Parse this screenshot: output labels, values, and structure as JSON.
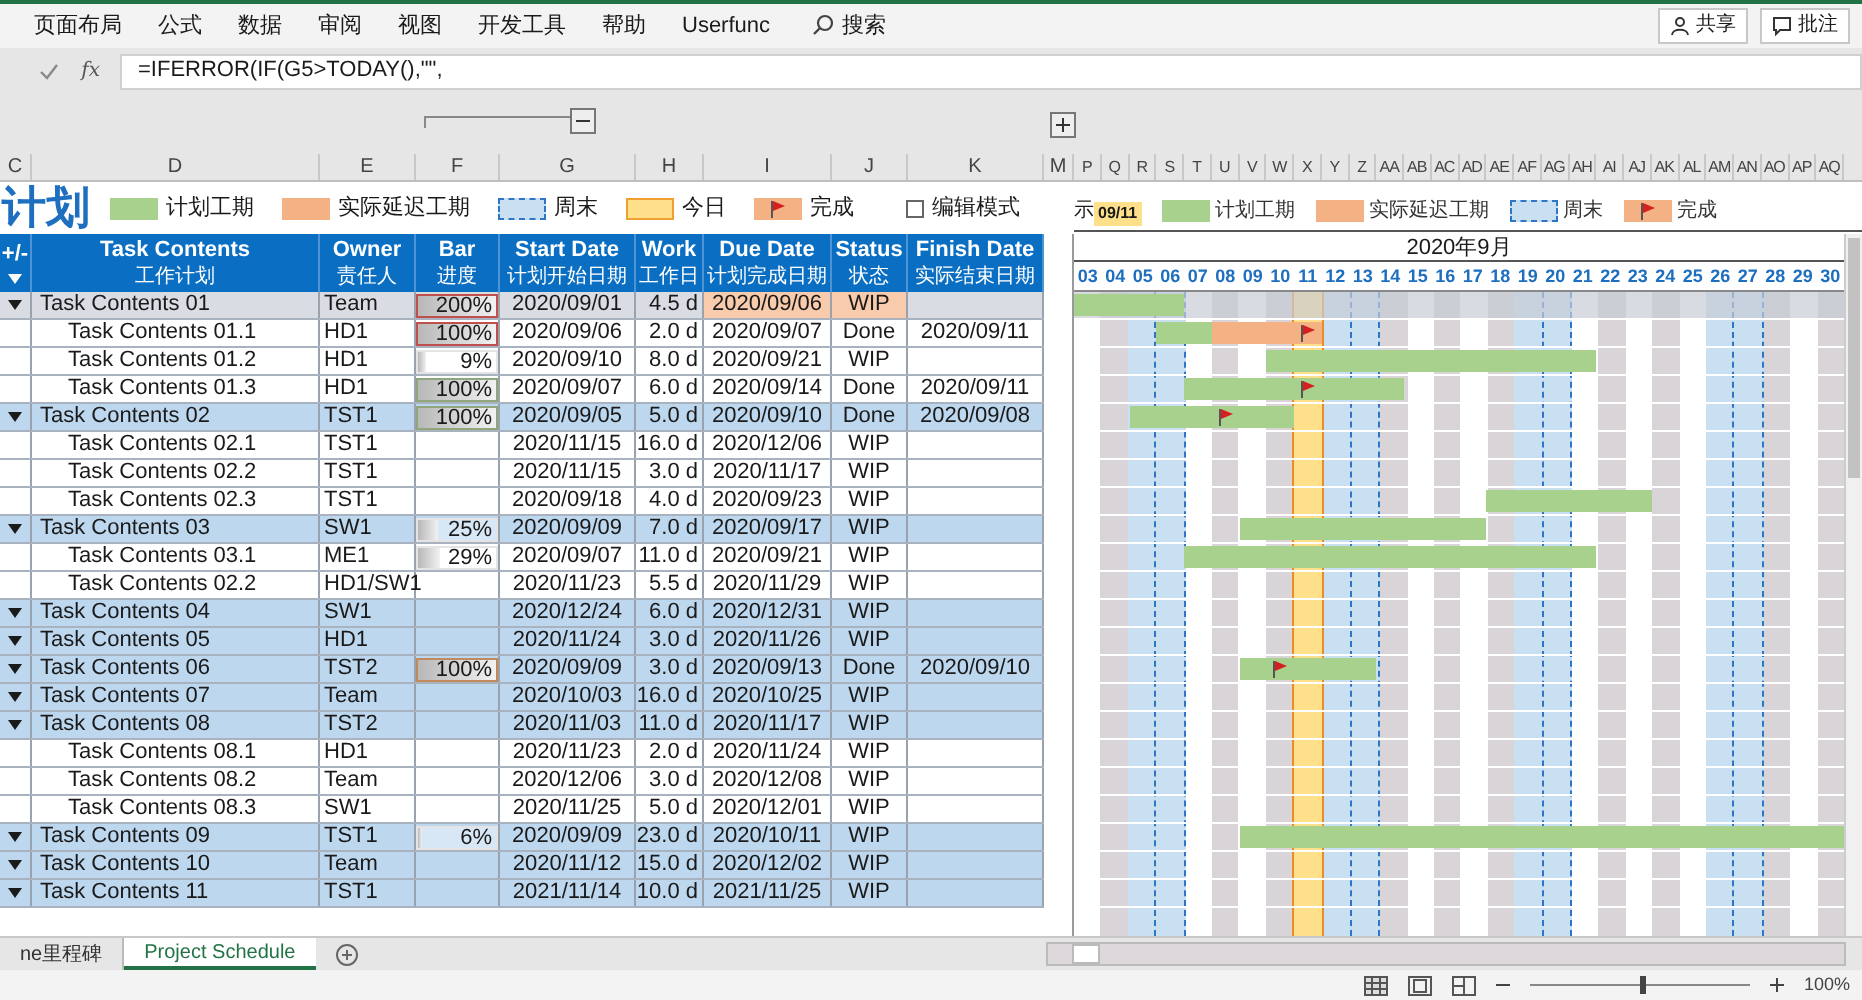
{
  "ribbon": {
    "tabs": [
      "页面布局",
      "公式",
      "数据",
      "审阅",
      "视图",
      "开发工具",
      "帮助",
      "Userfunc"
    ],
    "search": "搜索",
    "buttons": [
      "共享",
      "批注"
    ]
  },
  "formula_bar": {
    "fx": "fx",
    "formula": "=IFERROR(IF(G5>TODAY(),\"\","
  },
  "column_letters": {
    "left": [
      "C",
      "D",
      "E",
      "F",
      "G",
      "H",
      "I",
      "J",
      "K"
    ],
    "gap": "M",
    "right": [
      "P",
      "Q",
      "R",
      "S",
      "T",
      "U",
      "V",
      "W",
      "X",
      "Y",
      "Z",
      "AA",
      "AB",
      "AC",
      "AD",
      "AE",
      "AF",
      "AG",
      "AH",
      "AI",
      "AJ",
      "AK",
      "AL",
      "AM",
      "AN",
      "AO",
      "AP",
      "AQ"
    ]
  },
  "title": "计划",
  "legend": [
    {
      "kind": "plan",
      "label": "计划工期"
    },
    {
      "kind": "delay",
      "label": "实际延迟工期"
    },
    {
      "kind": "weekend",
      "label": "周末"
    },
    {
      "kind": "today",
      "label": "今日"
    },
    {
      "kind": "done",
      "label": "完成"
    }
  ],
  "edit_mode": {
    "label": "编辑模式",
    "checked": false
  },
  "gantt_legend": {
    "prefix": "示",
    "today": "09/11",
    "items": [
      {
        "kind": "plan",
        "label": "计划工期"
      },
      {
        "kind": "delay",
        "label": "实际延迟工期"
      },
      {
        "kind": "weekend",
        "label": "周末"
      },
      {
        "kind": "done",
        "label": "完成"
      }
    ]
  },
  "table": {
    "columns": [
      {
        "line1": "+/-",
        "kind": "outline"
      },
      {
        "line1": "Task Contents",
        "line2": "工作计划"
      },
      {
        "line1": "Owner",
        "line2": "责任人"
      },
      {
        "line1": "Bar",
        "line2": "进度"
      },
      {
        "line1": "Start Date",
        "line2": "计划开始日期"
      },
      {
        "line1": "Work",
        "line2": "工作日"
      },
      {
        "line1": "Due Date",
        "line2": "计划完成日期"
      },
      {
        "line1": "Status",
        "line2": "状态"
      },
      {
        "line1": "Finish Date",
        "line2": "实际结束日期"
      }
    ],
    "rows": [
      {
        "kind": "group",
        "selected": true,
        "overdue": true,
        "name": "Task Contents 01",
        "owner": "Team",
        "progress": {
          "text": "200%",
          "level": 1,
          "color": "#c0504d"
        },
        "start": "2020/09/01",
        "work": "4.5 d",
        "due": "2020/09/06",
        "status": "WIP"
      },
      {
        "kind": "task",
        "selected": false,
        "overdue": false,
        "name": "Task Contents 01.1",
        "owner": "HD1",
        "progress": {
          "text": "100%",
          "level": 1,
          "color": "#c0504d"
        },
        "start": "2020/09/06",
        "work": "2.0 d",
        "due": "2020/09/07",
        "status": "Done",
        "finish": "2020/09/11"
      },
      {
        "kind": "task",
        "selected": false,
        "overdue": false,
        "name": "Task Contents 01.2",
        "owner": "HD1",
        "progress": {
          "text": "9%",
          "level": 0.09
        },
        "start": "2020/09/10",
        "work": "8.0 d",
        "due": "2020/09/21",
        "status": "WIP"
      },
      {
        "kind": "task",
        "selected": false,
        "overdue": false,
        "name": "Task Contents 01.3",
        "owner": "HD1",
        "progress": {
          "text": "100%",
          "level": 1,
          "color": "#8fa67c"
        },
        "start": "2020/09/07",
        "work": "6.0 d",
        "due": "2020/09/14",
        "status": "Done",
        "finish": "2020/09/11"
      },
      {
        "kind": "group",
        "selected": false,
        "overdue": false,
        "name": "Task Contents 02",
        "owner": "TST1",
        "progress": {
          "text": "100%",
          "level": 1,
          "color": "#8fa67c"
        },
        "start": "2020/09/05",
        "work": "5.0 d",
        "due": "2020/09/10",
        "status": "Done",
        "finish": "2020/09/08"
      },
      {
        "kind": "task",
        "selected": false,
        "overdue": false,
        "name": "Task Contents 02.1",
        "owner": "TST1",
        "start": "2020/11/15",
        "work": "16.0 d",
        "due": "2020/12/06",
        "status": "WIP"
      },
      {
        "kind": "task",
        "selected": false,
        "overdue": false,
        "name": "Task Contents 02.2",
        "owner": "TST1",
        "start": "2020/11/15",
        "work": "3.0 d",
        "due": "2020/11/17",
        "status": "WIP"
      },
      {
        "kind": "task",
        "selected": false,
        "overdue": false,
        "name": "Task Contents 02.3",
        "owner": "TST1",
        "start": "2020/09/18",
        "work": "4.0 d",
        "due": "2020/09/23",
        "status": "WIP"
      },
      {
        "kind": "group",
        "selected": false,
        "overdue": false,
        "name": "Task Contents 03",
        "owner": "SW1",
        "progress": {
          "text": "25%",
          "level": 0.25
        },
        "start": "2020/09/09",
        "work": "7.0 d",
        "due": "2020/09/17",
        "status": "WIP"
      },
      {
        "kind": "task",
        "selected": false,
        "overdue": false,
        "name": "Task Contents 03.1",
        "owner": "ME1",
        "progress": {
          "text": "29%",
          "level": 0.29
        },
        "start": "2020/09/07",
        "work": "11.0 d",
        "due": "2020/09/21",
        "status": "WIP"
      },
      {
        "kind": "task",
        "selected": false,
        "overdue": false,
        "name": "Task Contents 02.2",
        "owner": "HD1/SW1",
        "start": "2020/11/23",
        "work": "5.5 d",
        "due": "2020/11/29",
        "status": "WIP"
      },
      {
        "kind": "group",
        "selected": false,
        "overdue": false,
        "name": "Task Contents 04",
        "owner": "SW1",
        "start": "2020/12/24",
        "work": "6.0 d",
        "due": "2020/12/31",
        "status": "WIP"
      },
      {
        "kind": "group",
        "selected": false,
        "overdue": false,
        "name": "Task Contents 05",
        "owner": "HD1",
        "start": "2020/11/24",
        "work": "3.0 d",
        "due": "2020/11/26",
        "status": "WIP"
      },
      {
        "kind": "group",
        "selected": false,
        "overdue": false,
        "name": "Task Contents 06",
        "owner": "TST2",
        "progress": {
          "text": "100%",
          "level": 1,
          "color": "#c08a5a"
        },
        "start": "2020/09/09",
        "work": "3.0 d",
        "due": "2020/09/13",
        "status": "Done",
        "finish": "2020/09/10"
      },
      {
        "kind": "group",
        "selected": false,
        "overdue": false,
        "name": "Task Contents 07",
        "owner": "Team",
        "start": "2020/10/03",
        "work": "16.0 d",
        "due": "2020/10/25",
        "status": "WIP"
      },
      {
        "kind": "group",
        "selected": false,
        "overdue": false,
        "name": "Task Contents 08",
        "owner": "TST2",
        "start": "2020/11/03",
        "work": "11.0 d",
        "due": "2020/11/17",
        "status": "WIP"
      },
      {
        "kind": "task",
        "selected": false,
        "overdue": false,
        "name": "Task Contents 08.1",
        "owner": "HD1",
        "start": "2020/11/23",
        "work": "2.0 d",
        "due": "2020/11/24",
        "status": "WIP"
      },
      {
        "kind": "task",
        "selected": false,
        "overdue": false,
        "name": "Task Contents 08.2",
        "owner": "Team",
        "start": "2020/12/06",
        "work": "3.0 d",
        "due": "2020/12/08",
        "status": "WIP"
      },
      {
        "kind": "task",
        "selected": false,
        "overdue": false,
        "name": "Task Contents 08.3",
        "owner": "SW1",
        "start": "2020/11/25",
        "work": "5.0 d",
        "due": "2020/12/01",
        "status": "WIP"
      },
      {
        "kind": "group",
        "selected": false,
        "overdue": false,
        "name": "Task Contents 09",
        "owner": "TST1",
        "progress": {
          "text": "6%",
          "level": 0.06
        },
        "start": "2020/09/09",
        "work": "23.0 d",
        "due": "2020/10/11",
        "status": "WIP"
      },
      {
        "kind": "group",
        "selected": false,
        "overdue": false,
        "name": "Task Contents 10",
        "owner": "Team",
        "start": "2020/11/12",
        "work": "15.0 d",
        "due": "2020/12/02",
        "status": "WIP"
      },
      {
        "kind": "group",
        "selected": false,
        "overdue": false,
        "name": "Task Contents 11",
        "owner": "TST1",
        "start": "2021/11/14",
        "work": "10.0 d",
        "due": "2021/11/25",
        "status": "WIP"
      }
    ]
  },
  "gantt": {
    "month": "2020年9月",
    "days": [
      {
        "label": "03",
        "kind": "day"
      },
      {
        "label": "04",
        "kind": "day"
      },
      {
        "label": "05",
        "kind": "weekend"
      },
      {
        "label": "06",
        "kind": "weekend"
      },
      {
        "label": "07",
        "kind": "day"
      },
      {
        "label": "08",
        "kind": "day"
      },
      {
        "label": "09",
        "kind": "day"
      },
      {
        "label": "10",
        "kind": "day"
      },
      {
        "label": "11",
        "kind": "today"
      },
      {
        "label": "12",
        "kind": "weekend"
      },
      {
        "label": "13",
        "kind": "weekend"
      },
      {
        "label": "14",
        "kind": "day"
      },
      {
        "label": "15",
        "kind": "day"
      },
      {
        "label": "16",
        "kind": "day"
      },
      {
        "label": "17",
        "kind": "day"
      },
      {
        "label": "18",
        "kind": "day"
      },
      {
        "label": "19",
        "kind": "weekend"
      },
      {
        "label": "20",
        "kind": "weekend"
      },
      {
        "label": "21",
        "kind": "day"
      },
      {
        "label": "22",
        "kind": "day"
      },
      {
        "label": "23",
        "kind": "day"
      },
      {
        "label": "24",
        "kind": "day"
      },
      {
        "label": "25",
        "kind": "day"
      },
      {
        "label": "26",
        "kind": "weekend"
      },
      {
        "label": "27",
        "kind": "weekend"
      },
      {
        "label": "28",
        "kind": "day"
      },
      {
        "label": "29",
        "kind": "day"
      },
      {
        "label": "30",
        "kind": "day"
      }
    ]
  },
  "sheet_tabs": [
    {
      "label": "ne里程碑",
      "selected": false
    },
    {
      "label": "Project Schedule",
      "selected": true
    }
  ],
  "status_bar": {
    "zoom": "100%",
    "zoom_slider": {
      "level": 0.5
    }
  }
}
